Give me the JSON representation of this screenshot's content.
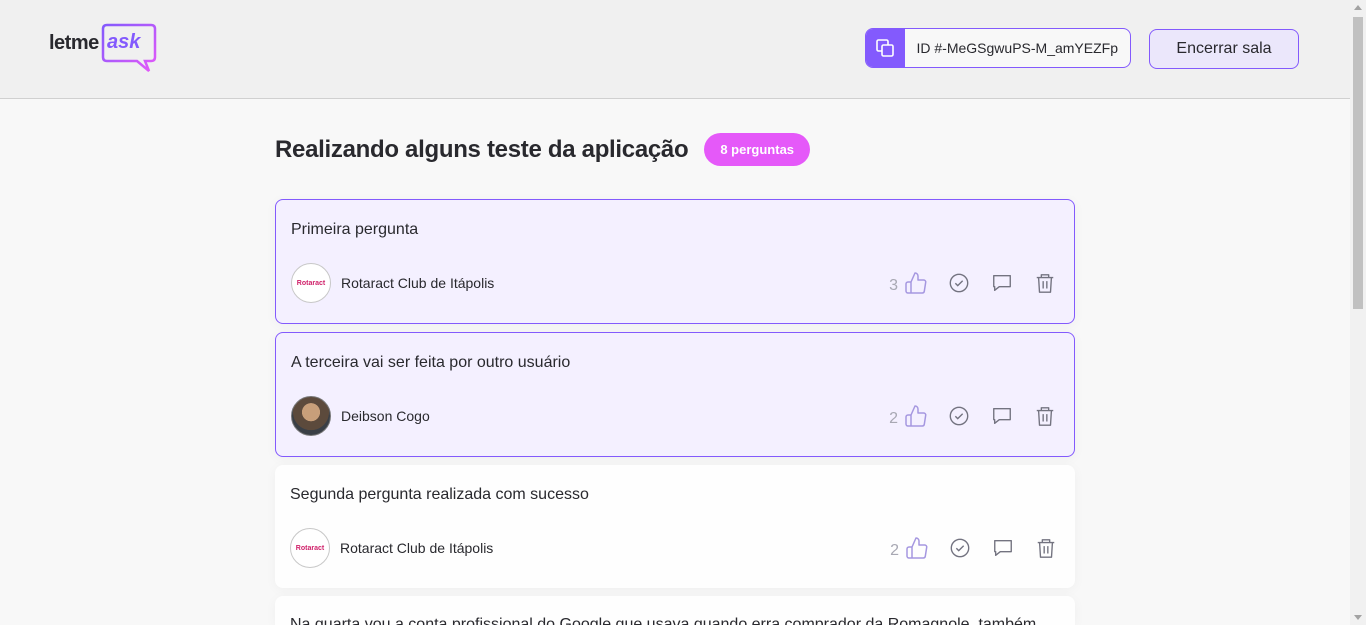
{
  "header": {
    "logo_left": "letme",
    "logo_right": "ask",
    "room_code": "ID #-MeGSgwuPS-M_amYEZFp",
    "end_button": "Encerrar sala"
  },
  "room": {
    "title": "Realizando alguns teste da aplicação",
    "count_badge": "8 perguntas"
  },
  "questions": [
    {
      "text": "Primeira pergunta",
      "author": "Rotaract Club de Itápolis",
      "likes": "3",
      "highlighted": true
    },
    {
      "text": "A terceira vai ser feita por outro usuário",
      "author": "Deibson Cogo",
      "likes": "2",
      "highlighted": true
    },
    {
      "text": "Segunda pergunta realizada com sucesso",
      "author": "Rotaract Club de Itápolis",
      "likes": "2",
      "highlighted": false
    },
    {
      "text": "Na quarta vou a conta profissional do Google que usava quando erra comprador da Romagnole, também",
      "author": "",
      "likes": "",
      "highlighted": false
    }
  ],
  "avatar_text": "Rotaract",
  "colors": {
    "purple": "#835afd",
    "pink": "#e559f9",
    "highlight_bg": "#f4f0ff"
  },
  "icons": [
    "copy-icon",
    "like-icon",
    "check-icon",
    "answer-icon",
    "trash-icon"
  ]
}
